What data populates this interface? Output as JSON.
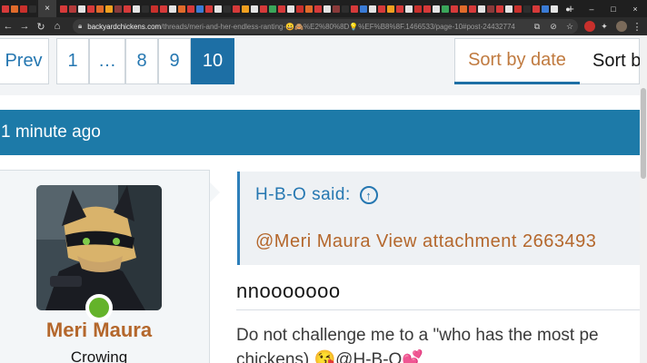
{
  "browser": {
    "active_tab_label": "×",
    "new_tab_label": "+",
    "tab_icon_colors": [
      "#d63a3a",
      "#e06b2b",
      "#c9302c",
      "#2e2e2e",
      "#d63a3a",
      "#b33a3a",
      "#e3e3e3",
      "#d63a3a",
      "#e06b2b",
      "#f0a020",
      "#8a3a3a",
      "#d63a3a",
      "#e3e3e3",
      "#2e2e2e",
      "#c9302c",
      "#d63a3a",
      "#e3e3e3",
      "#e06b2b",
      "#d63a3a",
      "#3a7bd5",
      "#d63a3a",
      "#e3e3e3",
      "#2e2e2e",
      "#d63a3a",
      "#f0a020",
      "#e3e3e3",
      "#d63a3a",
      "#3aa65a",
      "#d63a3a",
      "#e3e3e3",
      "#c9302c",
      "#e06b2b",
      "#d63a3a",
      "#e3e3e3",
      "#8a3a3a",
      "#2e2e2e",
      "#d63a3a",
      "#3a7bd5",
      "#e3e3e3",
      "#d63a3a",
      "#f0a020",
      "#d63a3a",
      "#e3e3e3",
      "#c9302c",
      "#d63a3a",
      "#e3e3e3",
      "#3aa65a",
      "#d63a3a",
      "#e06b2b",
      "#d63a3a",
      "#e3e3e3",
      "#8a3a3a",
      "#d63a3a",
      "#e3e3e3",
      "#c9302c",
      "#2e2e2e",
      "#d63a3a",
      "#3a7bd5",
      "#e3e3e3"
    ],
    "window_controls": [
      "●",
      "–",
      "□",
      "×"
    ],
    "nav_icons": [
      "←",
      "→",
      "↻",
      "⌂"
    ],
    "url_host": "backyardchickens.com",
    "url_path": "/threads/meri-and-her-endless-ranting-😀🙈%E2%80%8D💡%EF%B8%8F.1466533/page-10#post-24432774",
    "omnibox_icons": [
      "⧉",
      "⊘",
      "☆"
    ],
    "extension_colors": [
      "#c9302c",
      "#8a8a8a",
      "#7a6a5a"
    ],
    "menu_icon": "⋮"
  },
  "pagination": {
    "prev_label": "Prev",
    "pages": [
      "1",
      "…",
      "8",
      "9",
      "10"
    ],
    "current_page": "10"
  },
  "sort": {
    "by_date_label": "Sort by date",
    "other_label": "Sort b"
  },
  "post": {
    "time_ago": "1 minute ago",
    "user": {
      "name": "Meri Maura",
      "title": "Crowing"
    },
    "quote": {
      "attribution": "H-B-O said:",
      "up_icon": "↑",
      "body": "@Meri Maura View attachment 2663493"
    },
    "message_line1": "nnooooooo",
    "message_line2": "Do not challenge me to a \"who has the most pe",
    "message_line3": "chickens) 😘@H-B-O💕"
  },
  "colors": {
    "header_blue": "#1d7aa8",
    "link_blue": "#2577b1",
    "username_brown": "#b4672c",
    "online_green": "#64b32a"
  }
}
